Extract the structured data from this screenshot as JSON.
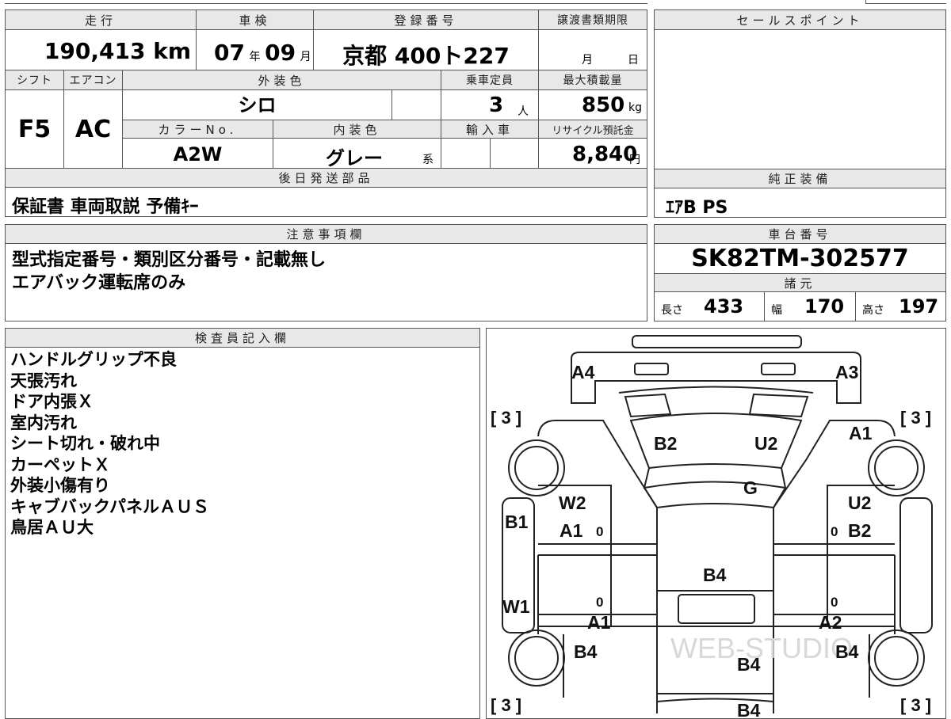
{
  "headers": {
    "mileage": "走行",
    "inspection": "車検",
    "registration": "登録番号",
    "transfer_deadline": "譲渡書類期限",
    "sales_point": "セールスポイント",
    "shift": "シフト",
    "aircon": "エアコン",
    "exterior_color": "外装色",
    "capacity": "乗車定員",
    "max_load": "最大積載量",
    "color_no": "カラーNo.",
    "interior_color": "内装色",
    "import": "輸入車",
    "recycle_fee": "リサイクル預託金",
    "later_parts": "後日発送部品",
    "genuine_equipment": "純正装備",
    "notes": "注意事項欄",
    "chassis_no": "車台番号",
    "specs": "諸元",
    "inspector_notes": "検査員記入欄"
  },
  "vehicle": {
    "mileage_value": "190,413",
    "mileage_unit": "km",
    "inspection_year": "07",
    "year_unit": "年",
    "inspection_month": "09",
    "month_unit": "月",
    "plate": "京都 400ト227",
    "deadline_month_unit": "月",
    "deadline_day_unit": "日",
    "shift": "F5",
    "aircon": "AC",
    "exterior_color": "シロ",
    "capacity": "3",
    "capacity_unit": "人",
    "max_load": "850",
    "max_load_unit": "kg",
    "color_no": "A2W",
    "interior_color": "グレー",
    "interior_suffix": "系",
    "recycle_fee": "8,840",
    "recycle_unit": "円",
    "later_parts": "保証書 車両取説 予備ｷｰ",
    "genuine_equipment": "ｴｱB PS",
    "chassis_no": "SK82TM-302577",
    "length_label": "長さ",
    "length": "433",
    "width_label": "幅",
    "width": "170",
    "height_label": "高さ",
    "height": "197"
  },
  "caution_notes": [
    "型式指定番号・類別区分番号・記載無し",
    "エアバック運転席のみ"
  ],
  "inspector_notes": [
    "ハンドルグリップ不良",
    "天張汚れ",
    "ドア内張Ｘ",
    "室内汚れ",
    "シート切れ・破れ中",
    "カーペットＸ",
    "外装小傷有り",
    "キャブバックパネルＡＵＳ",
    "鳥居ＡＵ大"
  ],
  "diagram": {
    "marks": {
      "a4": "A4",
      "a3": "A3",
      "b2_top": "B2",
      "u2_top": "U2",
      "a1_front_r": "A1",
      "g": "G",
      "w2": "W2",
      "a1_l": "A1",
      "b1": "B1",
      "u2_r": "U2",
      "b2_r": "B2",
      "b4_center": "B4",
      "w1": "W1",
      "a1_bottom": "A1",
      "a2_bottom": "A2",
      "b4_rear_l": "B4",
      "b4_rear_c": "B4",
      "b4_rear_r": "B4",
      "b4_bottom": "B4",
      "zero_1": "0",
      "zero_2": "0",
      "zero_3": "0",
      "zero_4": "0"
    },
    "bracket_marks": {
      "tl": "[ 3 ]",
      "tr": "[ 3 ]",
      "bl": "[ 3 ]",
      "br": "[ 3 ]"
    },
    "watermark": "WEB-STUDIO"
  }
}
